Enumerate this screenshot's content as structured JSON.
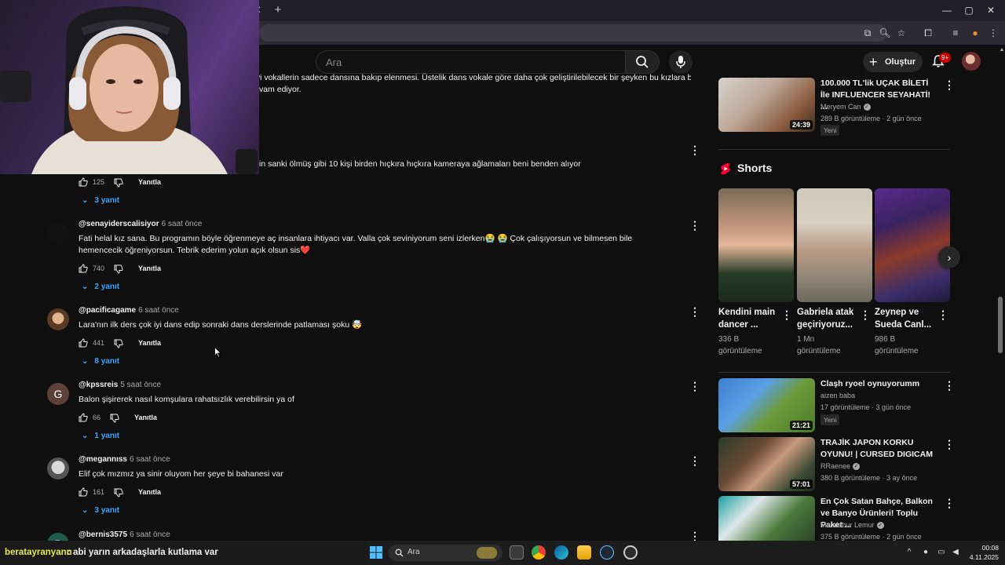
{
  "browser": {
    "window_controls": {
      "minimize": "—",
      "maximize": "▢",
      "close": "✕"
    },
    "new_tab": "+",
    "tab_close": "✕"
  },
  "header": {
    "search_placeholder": "Ara",
    "create_label": "Oluştur",
    "notification_count": "9+"
  },
  "comments_top_fragments": {
    "line1": "ayi vokallerin sadece dansına bakıp elenmesi. Üstelik dans vokale göre daha çok geliştirilebilecek bir şeyken bu kızlara bu",
    "line2": "vam ediyor.",
    "line3": "in sanki ölmüş gibi 10 kişi birden hıçkıra hıçkıra kameraya ağlamaları beni benden alıyor"
  },
  "comments": [
    {
      "author": "",
      "time": "",
      "text": "",
      "likes": "125",
      "reply_label": "Yanıtla",
      "replies": "3 yanıt"
    },
    {
      "author": "@senayiderscalisiyor",
      "time": "6 saat önce",
      "text": "Fati helal kız sana. Bu programın böyle öğrenmeye aç insanlara ihtiyacı var. Valla çok seviniyorum seni izlerken😭 😭 Çok çalışıyorsun ve bilmesen bile hemencecik öğreniyorsun. Tebrik ederim yolun açık olsun sis❤️",
      "likes": "740",
      "reply_label": "Yanıtla",
      "replies": "2 yanıt"
    },
    {
      "author": "@pacificagame",
      "time": "6 saat önce",
      "text": "Lara'nın ilk ders çok iyi dans edip sonraki dans derslerinde patlaması şoku 🤯",
      "likes": "441",
      "reply_label": "Yanıtla",
      "replies": "8 yanıt"
    },
    {
      "author": "@kpssreis",
      "time": "5 saat önce",
      "text": "Balon şişirerek nasıl komşulara rahatsızlık verebilirsin ya of",
      "likes": "66",
      "reply_label": "Yanıtla",
      "replies": "1 yanıt",
      "avatar_letter": "G"
    },
    {
      "author": "@megannıss",
      "time": "6 saat önce",
      "text": "Elif çok mızmız ya sinir oluyom her şeye bi bahanesi var",
      "likes": "161",
      "reply_label": "Yanıtla",
      "replies": "3 yanıt"
    },
    {
      "author": "@bernis3575",
      "time": "6 saat önce",
      "text": "",
      "avatar_letter": "B"
    }
  ],
  "sidebar": {
    "top_video": {
      "title": "100.000 TL'lik UÇAK BİLETİ İle INFLUENCER SEYAHATİ! ...",
      "channel": "Meryem Can",
      "views": "289 B görüntüleme",
      "age": "2 gün önce",
      "badge": "Yeni",
      "duration": "24:39"
    },
    "shorts_heading": "Shorts",
    "shorts": [
      {
        "title": "Kendini main dancer ...",
        "views": "336 B görüntüleme"
      },
      {
        "title": "Gabriela atak geçiriyoruz...",
        "views": "1 Mn görüntüleme"
      },
      {
        "title": "Zeynep ve Sueda Canl...",
        "views": "986 B görüntüleme"
      }
    ],
    "videos": [
      {
        "title": "Claşh ryoel oynuyorumm",
        "channel": "aizen baba",
        "verified": false,
        "views": "17 görüntüleme",
        "age": "3 gün önce",
        "badge": "Yeni",
        "duration": "21:21"
      },
      {
        "title": "TRAJİK JAPON KORKU OYUNU! | CURSED DIGICAM",
        "channel": "RRaenee",
        "verified": true,
        "views": "380 B görüntüleme",
        "age": "3 ay önce",
        "badge": "",
        "duration": "57:01"
      },
      {
        "title": "En Çok Satan Bahçe, Balkon ve Banyo Ürünleri! Toplu Paket ...",
        "channel": "Mendebur Lemur",
        "verified": true,
        "views": "375 B görüntüleme",
        "age": "2 gün önce",
        "badge": "",
        "duration": ""
      }
    ]
  },
  "chat": {
    "user": "beratayranyann",
    "message": ": abi yarın arkadaşlarla kutlama var"
  },
  "taskbar": {
    "search": "Ara",
    "time": "00:08",
    "date": "4.11.2025"
  },
  "colors": {
    "accent_link": "#3ea6ff",
    "background": "#0f0f0f",
    "notification": "#cc0000"
  }
}
